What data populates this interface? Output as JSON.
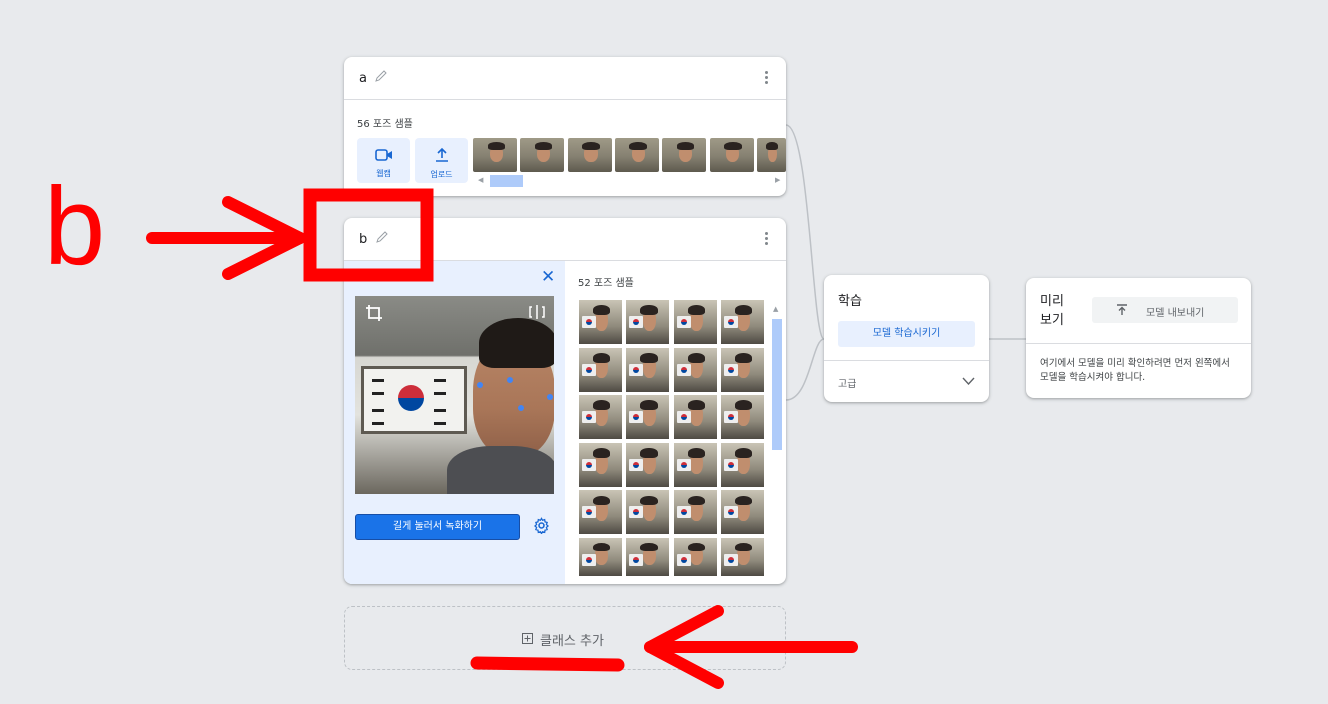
{
  "class_a": {
    "name": "a",
    "samples": "56 포즈 샘플",
    "webcam_label": "웹캠",
    "upload_label": "업로드",
    "thumb_count": 7
  },
  "class_b": {
    "name": "b",
    "samples": "52 포즈 샘플",
    "record_button": "길게 눌러서 녹화하기",
    "grid_rows": 6,
    "grid_cols": 4
  },
  "add_class": {
    "label": "클래스 추가"
  },
  "training": {
    "title": "학습",
    "train_button": "모델 학습시키기",
    "advanced": "고급"
  },
  "preview": {
    "title_line1": "미리",
    "title_line2": "보기",
    "export_button": "모델 내보내기",
    "message": "여기에서 모델을 미리 확인하려면 먼저 왼쪽에서 모델을 학습시켜야 합니다."
  },
  "annotation": {
    "letter": "b",
    "color": "#ff0000"
  },
  "colors": {
    "accent": "#1967d2",
    "button_bg": "#e8f0fe",
    "record_bg": "#1a73e8",
    "page_bg": "#e8eaed"
  }
}
